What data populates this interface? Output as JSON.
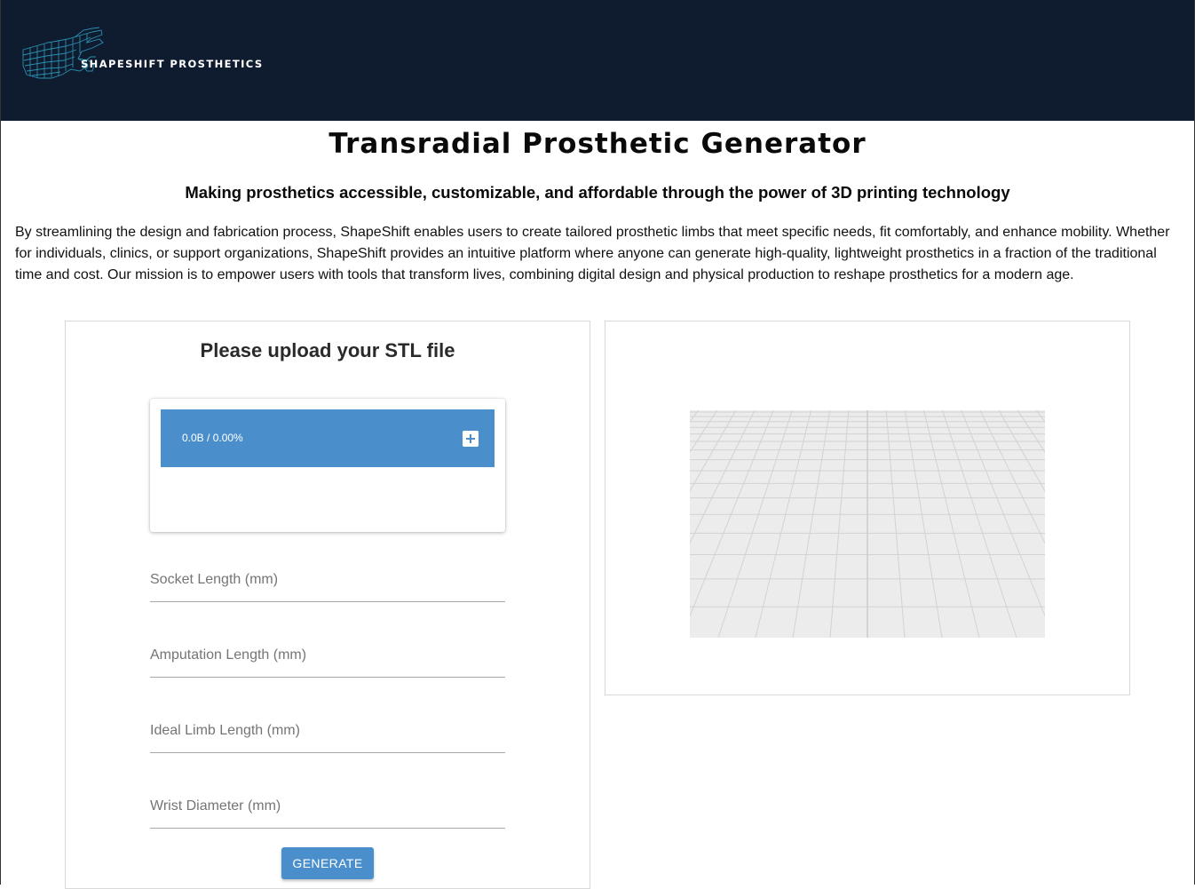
{
  "header": {
    "brand_name": "SHAPESHIFT PROSTHETICS",
    "background_color": "#0f1b2e",
    "logo_icon": "wireframe-hand-icon"
  },
  "main": {
    "title": "Transradial Prosthetic Generator",
    "subtitle": "Making prosthetics accessible, customizable, and affordable through the power of 3D printing technology",
    "description": "By streamlining the design and fabrication process, ShapeShift enables users to create tailored prosthetic limbs that meet specific needs, fit comfortably, and enhance mobility. Whether for individuals, clinics, or support organizations, ShapeShift provides an intuitive platform where anyone can generate high-quality, lightweight prosthetics in a fraction of the traditional time and cost. Our mission is to empower users with tools that transform lives, combining digital design and physical production to reshape prosthetics for a modern age."
  },
  "form": {
    "upload_heading": "Please upload your STL file",
    "upload_status": "0.0B / 0.00%",
    "upload_progress": 0,
    "add_file_icon": "plus-square-icon",
    "fields": {
      "socket_length": {
        "placeholder": "Socket Length (mm)",
        "value": ""
      },
      "amputation_length": {
        "placeholder": "Amputation Length (mm)",
        "value": ""
      },
      "ideal_limb_length": {
        "placeholder": "Ideal Limb Length (mm)",
        "value": ""
      },
      "wrist_diameter": {
        "placeholder": "Wrist Diameter (mm)",
        "value": ""
      }
    },
    "generate_label": "GENERATE"
  },
  "viewer": {
    "background_color": "#ececec",
    "grid_color": "#d4d4d4"
  },
  "colors": {
    "accent": "#4a8fcc",
    "header": "#0f1b2e"
  }
}
